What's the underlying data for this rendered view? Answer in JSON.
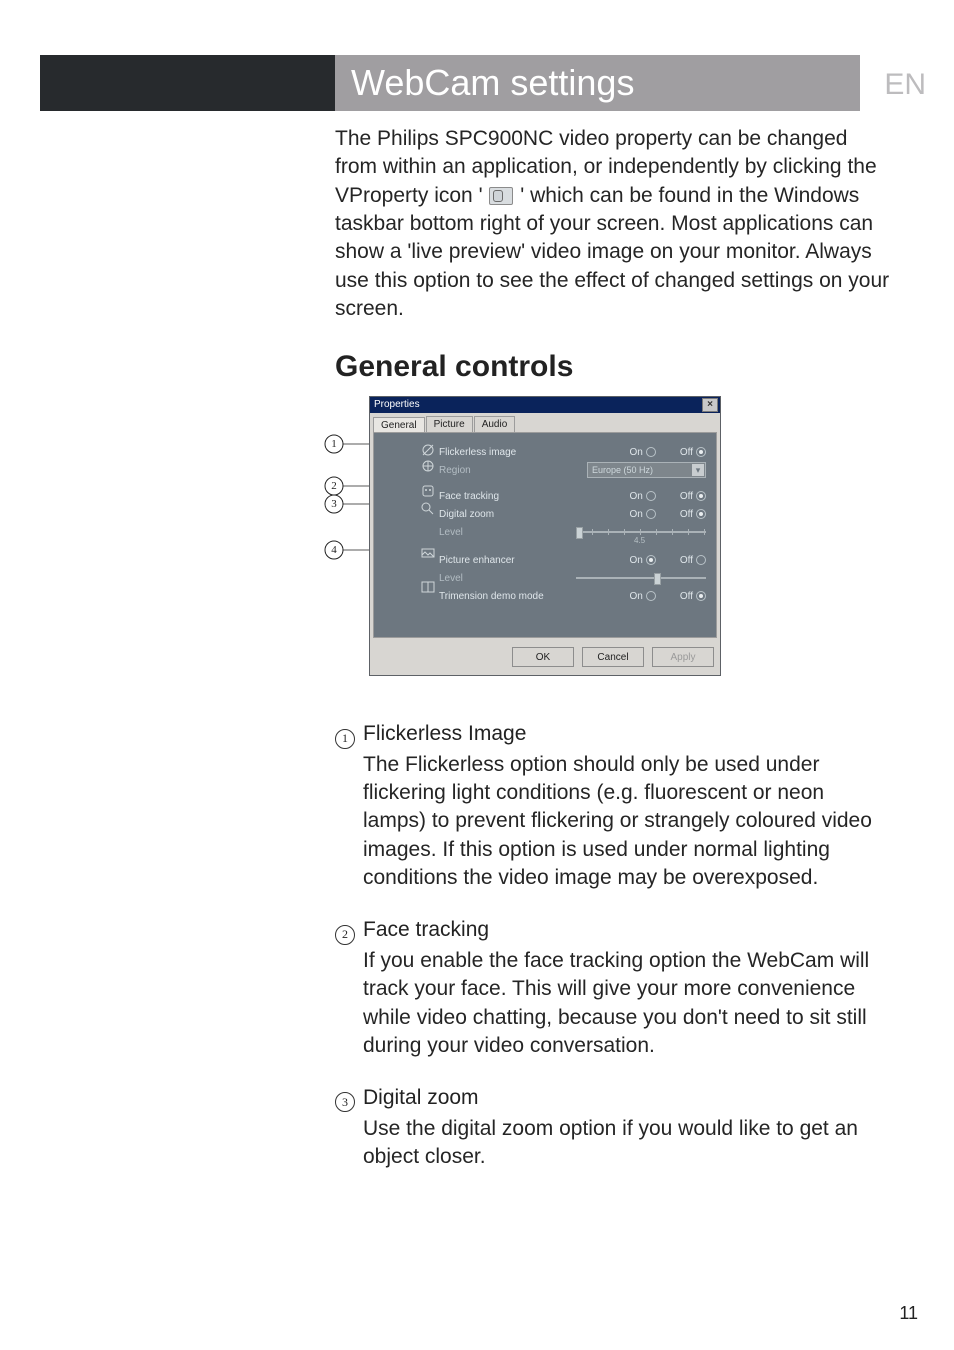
{
  "lang_tag": "EN",
  "chapter_title": "WebCam settings",
  "intro_before_icon": "The Philips SPC900NC video property can be changed from within an application, or independently by clicking the VProperty icon '",
  "intro_after_icon": "' which can be found in the Windows taskbar bottom right of your screen. Most applications can show a 'live preview' video image on your monitor. Always use this option to see the effect of changed settings on your screen.",
  "section_title": "General controls",
  "dialog": {
    "title": "Properties",
    "tabs": [
      "General",
      "Picture",
      "Audio"
    ],
    "active_tab": 0,
    "labels": {
      "on": "On",
      "off": "Off"
    },
    "rows": {
      "flickerless": {
        "label": "Flickerless image",
        "value": "off"
      },
      "region": {
        "label": "Region",
        "dropdown": "Europe (50 Hz)"
      },
      "facetrack": {
        "label": "Face tracking",
        "value": "off"
      },
      "dzoom": {
        "label": "Digital zoom",
        "value": "off"
      },
      "dzoom_level": {
        "label": "Level",
        "mid": "4.5"
      },
      "penh": {
        "label": "Picture enhancer",
        "value": "on"
      },
      "penh_level": {
        "label": "Level"
      },
      "trim": {
        "label": "Trimension demo mode",
        "value": "off"
      }
    },
    "buttons": {
      "ok": "OK",
      "cancel": "Cancel",
      "apply": "Apply"
    }
  },
  "callouts": [
    "1",
    "2",
    "3",
    "4"
  ],
  "items": [
    {
      "num": "1",
      "title": "Flickerless Image",
      "text": "The Flickerless option should only be used under flickering light conditions (e.g. fluorescent or neon lamps) to prevent flickering or strangely coloured video images. If this option is used under normal lighting conditions the video image may be overexposed."
    },
    {
      "num": "2",
      "title": "Face tracking",
      "text": "If you enable the face tracking option the WebCam will track your face. This will give your more convenience while video chatting, because you don't need to sit still during your video conversation."
    },
    {
      "num": "3",
      "title": "Digital zoom",
      "text": "Use the digital zoom option if you would like to get an object closer."
    }
  ],
  "page_number": "11"
}
